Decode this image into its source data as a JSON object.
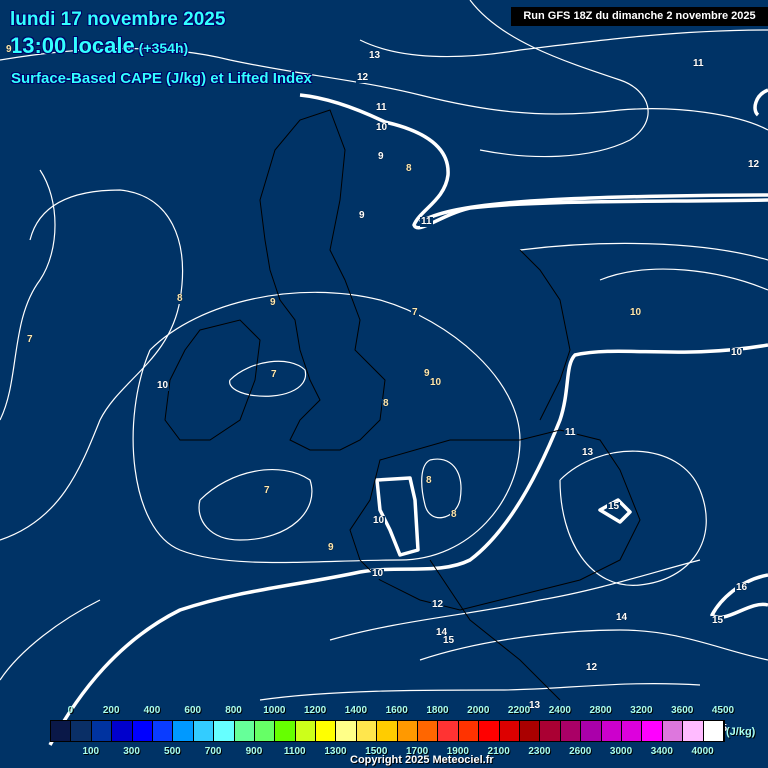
{
  "header": {
    "date": "lundi 17 novembre 2025",
    "time": "13:00 locale",
    "lead": "(+354h)",
    "product": "Surface-Based CAPE (J/kg) et Lifted Index",
    "run": "Run GFS 18Z du dimanche 2 novembre 2025"
  },
  "contour_labels": [
    "9",
    "13",
    "12",
    "11",
    "10",
    "9",
    "8",
    "9",
    "11",
    "11",
    "12",
    "8",
    "9",
    "7",
    "7",
    "10",
    "10",
    "10",
    "7",
    "9",
    "10",
    "8",
    "11",
    "13",
    "8",
    "7",
    "15",
    "10",
    "8",
    "9",
    "10",
    "12",
    "16",
    "14",
    "15",
    "14",
    "15",
    "12",
    "13",
    "15"
  ],
  "legend": {
    "unit": "(J/kg)",
    "top_ticks": [
      "0",
      "200",
      "400",
      "600",
      "800",
      "1000",
      "1200",
      "1400",
      "1600",
      "1800",
      "2000",
      "2200",
      "2400",
      "2800",
      "3200",
      "3600",
      "4500"
    ],
    "bottom_ticks": [
      "100",
      "300",
      "500",
      "700",
      "900",
      "1100",
      "1300",
      "1500",
      "1700",
      "1900",
      "2100",
      "2300",
      "2600",
      "3000",
      "3400",
      "4000"
    ],
    "colors": [
      "#0a1848",
      "#0a2f66",
      "#0033a0",
      "#0000cc",
      "#0000ff",
      "#0a3cff",
      "#0099ff",
      "#33ccff",
      "#66ffff",
      "#66ff99",
      "#66ff66",
      "#66ff00",
      "#ccff1a",
      "#ffff00",
      "#ffff88",
      "#ffe64d",
      "#ffcc00",
      "#ff9900",
      "#ff6600",
      "#ff3333",
      "#ff3300",
      "#ff0000",
      "#dd0000",
      "#aa0000",
      "#aa0033",
      "#aa0066",
      "#aa00aa",
      "#cc00cc",
      "#dd00dd",
      "#ff00ff",
      "#dd77dd",
      "#ffbbff",
      "#ffffff"
    ]
  },
  "copyright": "Copyright 2025 Meteociel.fr"
}
